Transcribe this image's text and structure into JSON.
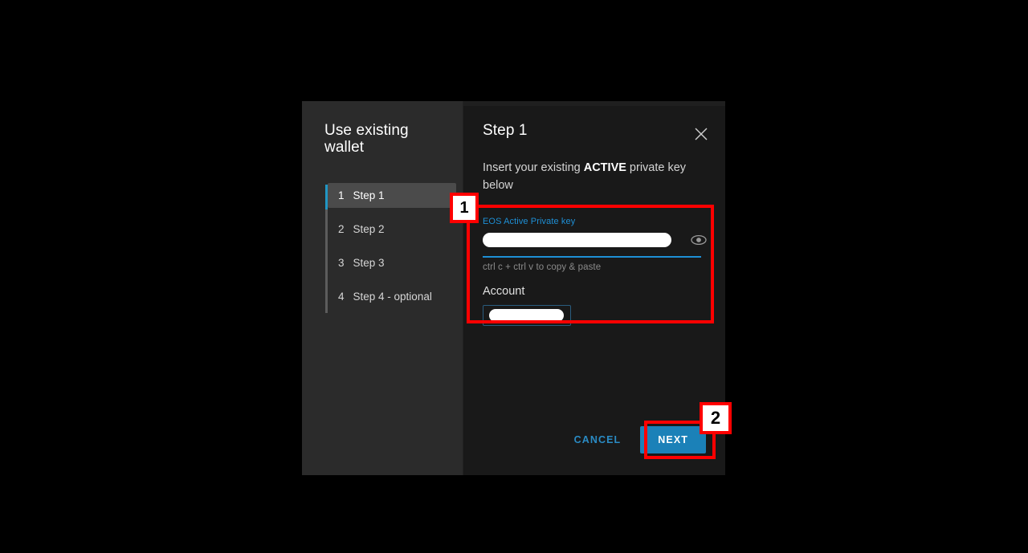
{
  "dialog": {
    "sidebar": {
      "title": "Use existing wallet",
      "steps": [
        {
          "num": "1",
          "label": "Step 1",
          "active": true
        },
        {
          "num": "2",
          "label": "Step 2",
          "active": false
        },
        {
          "num": "3",
          "label": "Step 3",
          "active": false
        },
        {
          "num": "4",
          "label": "Step 4 - optional",
          "active": false
        }
      ]
    },
    "content": {
      "title": "Step 1",
      "close_icon": "close-icon",
      "subtitle_prefix": "Insert your existing ",
      "subtitle_strong": "ACTIVE",
      "subtitle_suffix": " private key below",
      "field": {
        "label": "EOS Active Private key",
        "value": "",
        "placeholder": "",
        "reveal_icon": "eye-icon",
        "helper": "ctrl c + ctrl v to copy & paste"
      },
      "account": {
        "label": "Account",
        "value": "",
        "placeholder": ""
      },
      "actions": {
        "cancel_label": "CANCEL",
        "next_label": "NEXT"
      }
    }
  },
  "annotations": [
    {
      "id": "1",
      "target": "private-key-form-area"
    },
    {
      "id": "2",
      "target": "next-button"
    }
  ],
  "colors": {
    "accent_blue": "#1e8fd5",
    "button_blue": "#1b81b8",
    "annotation_red": "#ff0000",
    "sidebar_bg": "#2b2b2b",
    "content_bg": "#191919",
    "page_bg": "#000000"
  }
}
